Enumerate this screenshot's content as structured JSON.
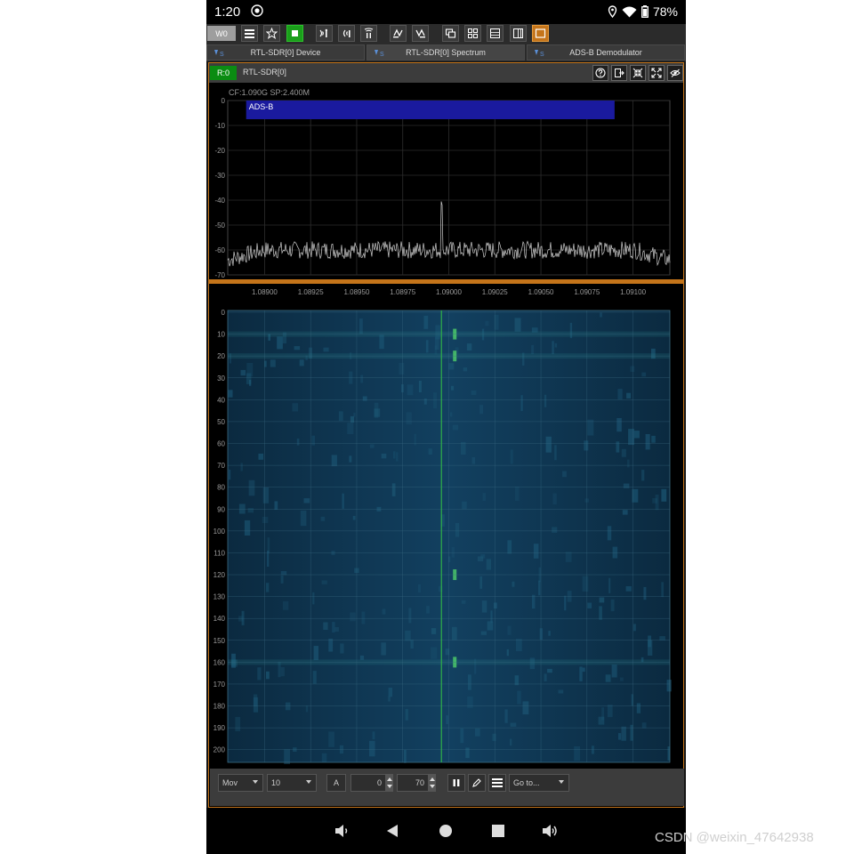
{
  "status": {
    "time": "1:20",
    "battery": "78%"
  },
  "toolbar": {
    "workspace_label": "W0"
  },
  "tabs": [
    {
      "label": "RTL-SDR[0] Device",
      "icon": "sdr-tab-icon"
    },
    {
      "label": "RTL-SDR[0] Spectrum",
      "icon": "sdr-tab-icon"
    },
    {
      "label": "ADS-B Demodulator",
      "icon": "sdr-tab-icon"
    }
  ],
  "panel": {
    "badge": "R:0",
    "device_name": "RTL-SDR[0]",
    "cf_sp": "CF:1.090G SP:2.400M"
  },
  "spectrum": {
    "band_label": "ADS-B",
    "y_ticks": [
      "0",
      "-10",
      "-20",
      "-30",
      "-40",
      "-50",
      "-60",
      "-70"
    ],
    "x_ticks": [
      "1.08900",
      "1.08925",
      "1.08950",
      "1.08975",
      "1.09000",
      "1.09025",
      "1.09050",
      "1.09075",
      "1.09100"
    ],
    "ylim": [
      -70,
      0
    ],
    "xlim": [
      1.0888,
      1.0912
    ],
    "band": [
      1.0889,
      1.0909
    ],
    "noise_floor_db": -60,
    "peak": {
      "x": 1.08996,
      "db": -42
    },
    "trace_color": "#d0d0d0",
    "band_color": "#1a1a9e"
  },
  "waterfall": {
    "y_ticks": [
      "0",
      "10",
      "20",
      "30",
      "40",
      "50",
      "60",
      "70",
      "80",
      "90",
      "100",
      "110",
      "120",
      "130",
      "140",
      "150",
      "160",
      "170",
      "180",
      "190",
      "200"
    ],
    "line_color": "#2fb24a",
    "bg_color": "#0f2f45"
  },
  "controls": {
    "mode_value": "Mov",
    "avg_value": "10",
    "auto_label": "A",
    "min_value": "0",
    "max_value": "70",
    "goto_value": "Go to..."
  },
  "colors": {
    "accent": "#c4741a",
    "run_green": "#1a9e1a"
  },
  "watermark": "CSDN @weixin_47642938"
}
